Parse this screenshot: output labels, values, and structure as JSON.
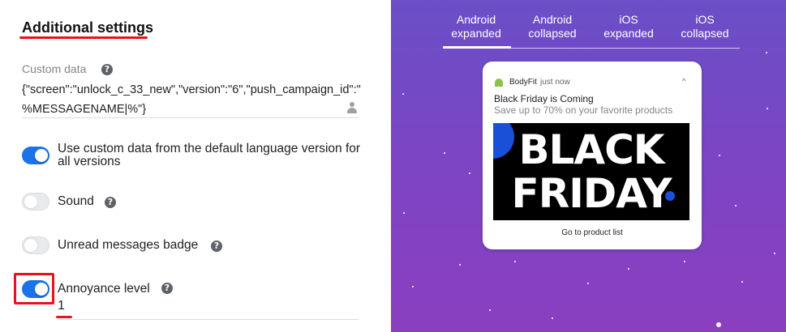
{
  "settings": {
    "section_title": "Additional settings",
    "custom_data": {
      "label": "Custom data",
      "value": "{\"screen\":\"unlock_c_33_new\",\"version\":\"6\",\"push_campaign_id\":\" %MESSAGENAME|%\"}"
    },
    "use_custom_data": {
      "label": "Use custom data from the default language version for all versions",
      "enabled": true
    },
    "sound": {
      "label": "Sound",
      "enabled": false
    },
    "unread_badge": {
      "label": "Unread messages badge",
      "enabled": false
    },
    "annoyance": {
      "label": "Annoyance level",
      "enabled": true,
      "value": "1"
    },
    "help_glyph": "?"
  },
  "preview": {
    "tabs": [
      {
        "label_line1": "Android",
        "label_line2": "expanded",
        "active": true
      },
      {
        "label_line1": "Android",
        "label_line2": "collapsed",
        "active": false
      },
      {
        "label_line1": "iOS",
        "label_line2": "expanded",
        "active": false
      },
      {
        "label_line1": "iOS",
        "label_line2": "collapsed",
        "active": false
      }
    ],
    "notification": {
      "app_name": "BodyFit",
      "time": "just now",
      "caret": "^",
      "title": "Black Friday is Coming",
      "body": "Save up to 70% on your favorite products",
      "image_line1": "BLACK",
      "image_line2": "FRIDAY",
      "action": "Go to product list"
    }
  },
  "colors": {
    "accent_red": "#e8131a",
    "toggle_on": "#1a73e8",
    "preview_bg_top": "#6a4fc7",
    "preview_bg_bottom": "#8a3fc0",
    "android_green": "#8bc34a"
  }
}
